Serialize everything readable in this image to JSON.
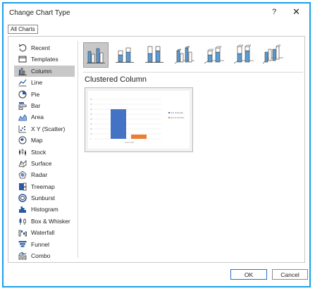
{
  "dialog": {
    "title": "Change Chart Type",
    "help_label": "?",
    "close_label": "✕"
  },
  "tabs": [
    {
      "label": "All Charts"
    }
  ],
  "sidebar": {
    "items": [
      {
        "label": "Recent",
        "icon": "recent-icon"
      },
      {
        "label": "Templates",
        "icon": "templates-icon"
      },
      {
        "label": "Column",
        "icon": "column-chart-icon",
        "selected": true
      },
      {
        "label": "Line",
        "icon": "line-chart-icon"
      },
      {
        "label": "Pie",
        "icon": "pie-chart-icon"
      },
      {
        "label": "Bar",
        "icon": "bar-chart-icon"
      },
      {
        "label": "Area",
        "icon": "area-chart-icon"
      },
      {
        "label": "X Y (Scatter)",
        "icon": "scatter-chart-icon"
      },
      {
        "label": "Map",
        "icon": "map-chart-icon"
      },
      {
        "label": "Stock",
        "icon": "stock-chart-icon"
      },
      {
        "label": "Surface",
        "icon": "surface-chart-icon"
      },
      {
        "label": "Radar",
        "icon": "radar-chart-icon"
      },
      {
        "label": "Treemap",
        "icon": "treemap-chart-icon"
      },
      {
        "label": "Sunburst",
        "icon": "sunburst-chart-icon"
      },
      {
        "label": "Histogram",
        "icon": "histogram-chart-icon"
      },
      {
        "label": "Box & Whisker",
        "icon": "box-whisker-chart-icon"
      },
      {
        "label": "Waterfall",
        "icon": "waterfall-chart-icon"
      },
      {
        "label": "Funnel",
        "icon": "funnel-chart-icon"
      },
      {
        "label": "Combo",
        "icon": "combo-chart-icon"
      }
    ]
  },
  "chart_subtypes": [
    {
      "icon": "clustered-column-icon",
      "selected": true
    },
    {
      "icon": "stacked-column-icon"
    },
    {
      "icon": "100-stacked-column-icon"
    },
    {
      "icon": "3d-clustered-column-icon"
    },
    {
      "icon": "3d-stacked-column-icon"
    },
    {
      "icon": "3d-100-stacked-column-icon"
    },
    {
      "icon": "3d-column-icon"
    }
  ],
  "subtype_title": "Clustered Column",
  "preview": {
    "legend": [
      "Sum of Quantity",
      "Sum of Unit Price"
    ],
    "colors": [
      "#4472c4",
      "#ed7d31"
    ]
  },
  "footer": {
    "ok_label": "OK",
    "cancel_label": "Cancel"
  }
}
